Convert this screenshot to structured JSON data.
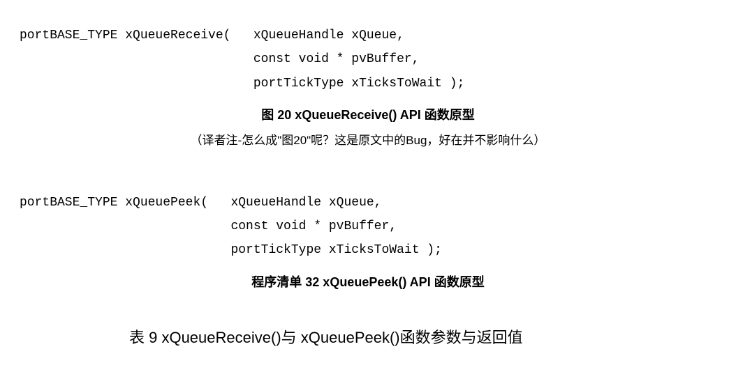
{
  "code1": {
    "line1": "portBASE_TYPE xQueueReceive(   xQueueHandle xQueue,",
    "line2": "                               const void * pvBuffer,",
    "line3": "                               portTickType xTicksToWait );"
  },
  "caption1": "图 20   xQueueReceive() API 函数原型",
  "note1": "（译者注-怎么成\"图20\"呢？这是原文中的Bug，好在并不影响什么）",
  "code2": {
    "line1": "portBASE_TYPE xQueuePeek(   xQueueHandle xQueue,",
    "line2": "                            const void * pvBuffer,",
    "line3": "                            portTickType xTicksToWait );"
  },
  "caption2": "程序清单 32   xQueuePeek() API 函数原型",
  "tableTitle": "表 9   xQueueReceive()与 xQueuePeek()函数参数与返回值"
}
